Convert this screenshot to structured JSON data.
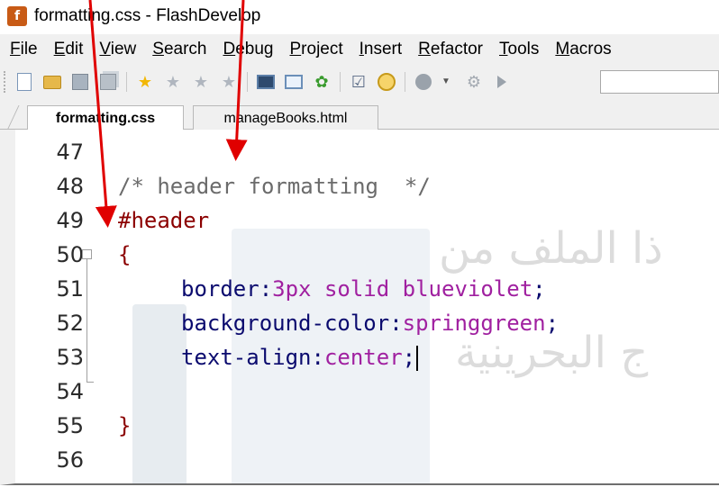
{
  "window": {
    "title": "formatting.css - FlashDevelop",
    "app_icon_glyph": "f"
  },
  "menu": {
    "items": [
      {
        "mnemonic": "F",
        "rest": "ile"
      },
      {
        "mnemonic": "E",
        "rest": "dit"
      },
      {
        "mnemonic": "V",
        "rest": "iew"
      },
      {
        "mnemonic": "S",
        "rest": "earch"
      },
      {
        "mnemonic": "D",
        "rest": "ebug"
      },
      {
        "mnemonic": "P",
        "rest": "roject"
      },
      {
        "mnemonic": "I",
        "rest": "nsert"
      },
      {
        "mnemonic": "R",
        "rest": "efactor"
      },
      {
        "mnemonic": "T",
        "rest": "ools"
      },
      {
        "mnemonic": "M",
        "rest": "acros"
      }
    ]
  },
  "toolbar": {
    "icons": [
      "new-file-icon",
      "open-folder-icon",
      "save-icon",
      "save-all-icon",
      "bookmark-star-icon",
      "star-icon",
      "star-icon",
      "star-icon",
      "console-window-icon",
      "panel-window-icon",
      "plant-icon",
      "checklist-icon",
      "clock-icon",
      "ball-icon",
      "gear-icon",
      "play-icon"
    ],
    "star_color": "#f2b705"
  },
  "tabs": [
    {
      "label": "formatting.css",
      "active": true
    },
    {
      "label": "manageBooks.html",
      "active": false
    }
  ],
  "editor": {
    "lines": [
      {
        "num": "47",
        "text": ""
      },
      {
        "num": "48",
        "text": "/* header formatting  */"
      },
      {
        "num": "49",
        "text": "#header"
      },
      {
        "num": "50",
        "text": "{"
      },
      {
        "num": "51",
        "prop": "border",
        "value": "3px solid blueviolet"
      },
      {
        "num": "52",
        "prop": "background-color",
        "value": "springgreen"
      },
      {
        "num": "53",
        "prop": "text-align",
        "value": "center"
      },
      {
        "num": "54",
        "text": ""
      },
      {
        "num": "55",
        "text": "}"
      },
      {
        "num": "56",
        "text": ""
      }
    ],
    "watermark_line1": "ذا الملف من",
    "watermark_line2": "ج البحرينية"
  },
  "annotation": {
    "arrow_color": "#e00000"
  }
}
